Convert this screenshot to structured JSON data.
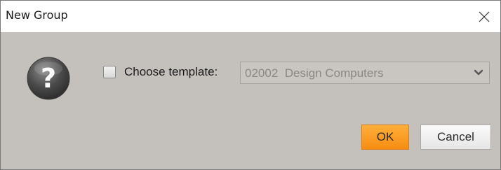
{
  "window": {
    "title": "New Group",
    "close_icon": "close-icon"
  },
  "body": {
    "icon": "question-icon",
    "checkbox": {
      "label": "Choose template:",
      "checked": false
    },
    "template_select": {
      "value": "02002  Design Computers",
      "enabled": false,
      "arrow_icon": "chevron-down-icon"
    }
  },
  "buttons": {
    "ok_label": "OK",
    "cancel_label": "Cancel"
  },
  "colors": {
    "dialog_background": "#c4c1bd",
    "ok_button": "#f7951e",
    "title_bar": "#ffffff"
  }
}
